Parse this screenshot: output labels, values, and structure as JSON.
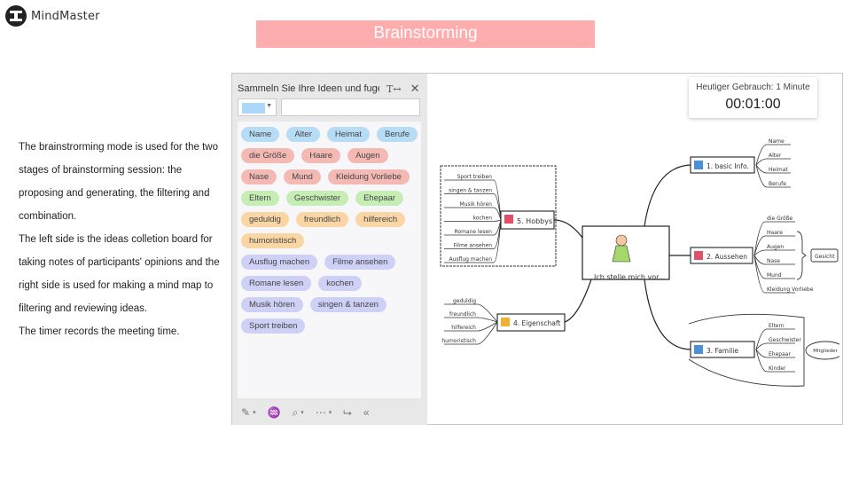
{
  "app": {
    "logo_text": "MindMaster"
  },
  "banner": {
    "title": "Brainstorming"
  },
  "description": {
    "lines": [
      "The brainstrorming mode is used for the two",
      "stages of brainstorming session: the",
      "proposing and generating, the filtering and",
      "combination.",
      "The left side is the ideas colletion board  for",
      "taking notes of participants' opinions and the",
      "right side is used for making a mind map to",
      "filtering and reviewing ideas.",
      "The timer records the meeting time."
    ]
  },
  "ideas_panel": {
    "title": "Sammeln Sie Ihre Ideen und fuge...",
    "font_icon": "T↔",
    "close_icon": "✕",
    "selected_color": "#aed8fb",
    "input_value": "",
    "chip_rows": [
      [
        {
          "label": "Name",
          "color": "blue"
        },
        {
          "label": "Alter",
          "color": "blue"
        },
        {
          "label": "Heimat",
          "color": "blue"
        },
        {
          "label": "Berufe",
          "color": "blue"
        }
      ],
      [
        {
          "label": "die Größe",
          "color": "red"
        },
        {
          "label": "Haare",
          "color": "red"
        },
        {
          "label": "Augen",
          "color": "red"
        }
      ],
      [
        {
          "label": "Nase",
          "color": "red"
        },
        {
          "label": "Mund",
          "color": "red"
        },
        {
          "label": "Kleidung Vorliebe",
          "color": "red"
        }
      ],
      [
        {
          "label": "Eltern",
          "color": "green"
        },
        {
          "label": "Geschwister",
          "color": "green"
        },
        {
          "label": "Ehepaar",
          "color": "green"
        }
      ],
      [
        {
          "label": "geduldig",
          "color": "orange"
        },
        {
          "label": "freundlich",
          "color": "orange"
        },
        {
          "label": "hilfereich",
          "color": "orange"
        }
      ],
      [
        {
          "label": "humoristisch",
          "color": "orange"
        }
      ],
      [
        {
          "label": "Ausflug machen",
          "color": "purple"
        },
        {
          "label": "Filme ansehen",
          "color": "purple"
        }
      ],
      [
        {
          "label": "Romane lesen",
          "color": "purple"
        },
        {
          "label": "kochen",
          "color": "purple"
        }
      ],
      [
        {
          "label": "Musik hören",
          "color": "purple"
        },
        {
          "label": "singen & tanzen",
          "color": "purple"
        }
      ],
      [
        {
          "label": "Sport treiben",
          "color": "purple"
        }
      ]
    ],
    "toolbar": {
      "pen_icon": "✎",
      "bulb_icon": "♒",
      "search_icon": "⌕",
      "more_icon": "⋯",
      "export_icon": "⮡",
      "collapse_icon": "«"
    }
  },
  "timer": {
    "label": "Heutiger Gebrauch: 1 Minute",
    "value": "00:01:00"
  },
  "mindmap": {
    "central": "Ich stelle mich vor...",
    "branches": {
      "basic": {
        "label": "1. basic Info.",
        "icon_color": "#4a90d9",
        "children": [
          "Name",
          "Alter",
          "Heimat",
          "Berufe"
        ]
      },
      "aussehen": {
        "label": "2. Aussehen",
        "icon_color": "#e0506a",
        "children": [
          "die Größe",
          "Haare",
          "Augen",
          "Nase",
          "Mund",
          "Kleidung Vorliebe"
        ],
        "group_label": "Gesicht"
      },
      "familie": {
        "label": "3. Familie",
        "icon_color": "#4a90d9",
        "children": [
          "Eltern",
          "Geschwister",
          "Ehepaar",
          "Kinder"
        ],
        "group_label": "Mitglieder"
      },
      "eigenschaft": {
        "label": "4. Eigenschaft",
        "icon_color": "#f0b030",
        "children": [
          "geduldig",
          "freundlich",
          "hilfereich",
          "humoristisch"
        ]
      },
      "hobbys": {
        "label": "5. Hobbys",
        "icon_color": "#e0506a",
        "children": [
          "Sport treiben",
          "singen & tanzen",
          "Musik hören",
          "kochen",
          "Romane lesen",
          "Filme ansehen",
          "Ausflug machen"
        ]
      }
    }
  }
}
